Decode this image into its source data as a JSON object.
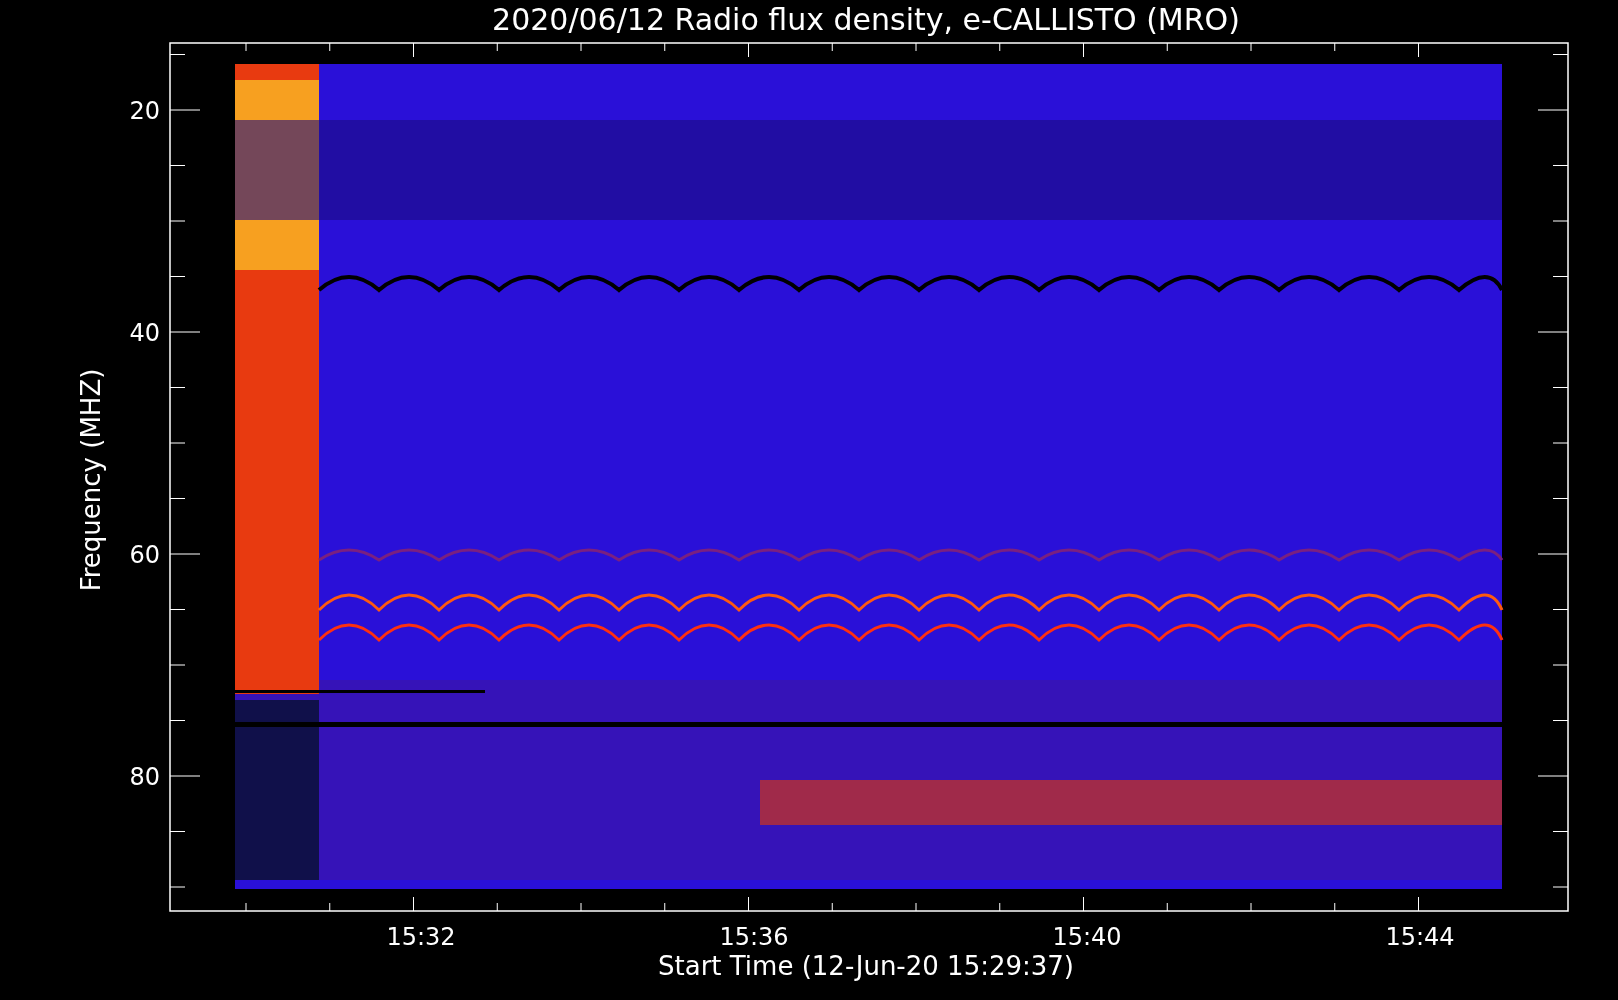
{
  "title": "2020/06/12  Radio flux density, e-CALLISTO (MRO)",
  "plot": {
    "ylabel": "Frequency (MHZ)",
    "xlabel": "Start Time (12-Jun-20 15:29:37)",
    "x_tick_labels": [
      "15:32",
      "15:36",
      "15:40",
      "15:44"
    ],
    "y_tick_labels": [
      "20",
      "40",
      "60",
      "80"
    ]
  }
}
